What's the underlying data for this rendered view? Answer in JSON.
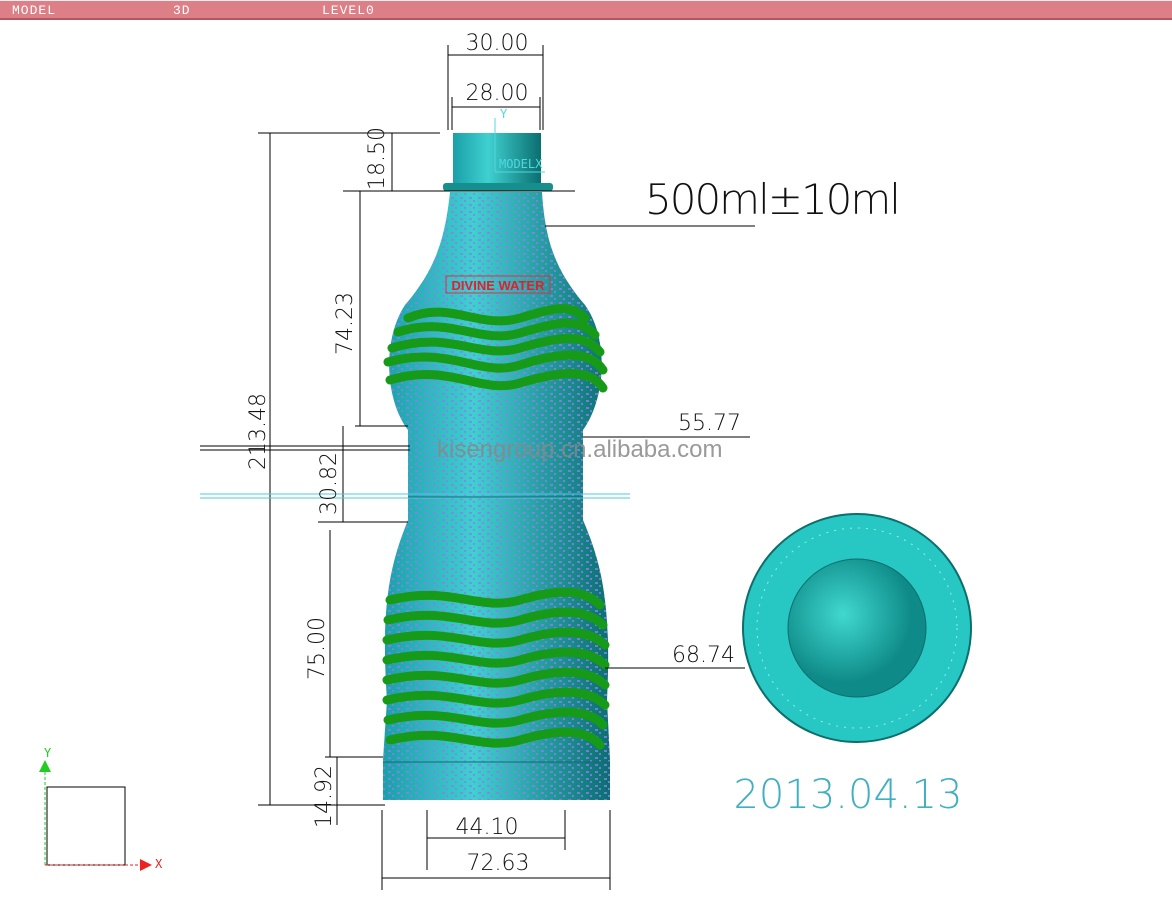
{
  "toolbar": {
    "mode": "MODEL",
    "view": "3D",
    "level": "LEVEL0"
  },
  "dimensions": {
    "neck_outer": "30.00",
    "neck_inner": "28.00",
    "finish_height": "18.50",
    "shoulder_height": "74.23",
    "total_height": "213.48",
    "waist_height": "30.82",
    "lower_body_height": "75.00",
    "base_height": "14.92",
    "base_inner": "44.10",
    "base_outer": "72.63",
    "waist_diameter": "55.77",
    "body_diameter": "68.74"
  },
  "volume_label": "500ml±10ml",
  "brand_label": "DIVINE WATER",
  "watermark": "kisengroup.cn.alibaba.com",
  "date": "2013.04.13",
  "model_axis": {
    "y": "Y",
    "x": "MODELX"
  },
  "view_axis": {
    "y": "Y",
    "x": "X"
  },
  "colors": {
    "bottle": "#1fa6a6",
    "speckle": "#8a7ef0",
    "rings": "#1a9a1a",
    "cap": "#2bb5b0",
    "date": "#3fb0c0"
  }
}
